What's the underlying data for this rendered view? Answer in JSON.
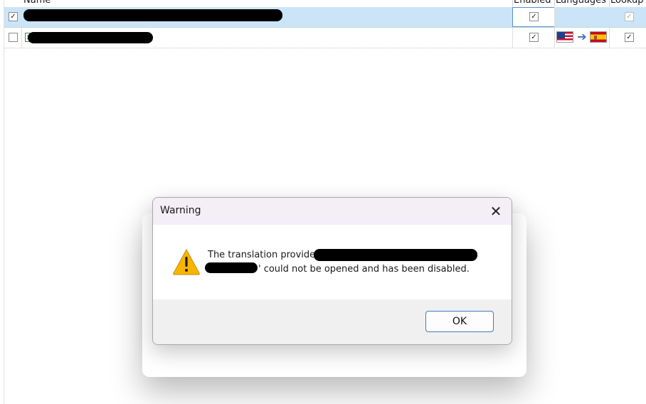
{
  "grid": {
    "columns": [
      {
        "key": "name",
        "label": "Name"
      },
      {
        "key": "enabled",
        "label": "Enabled"
      },
      {
        "key": "languages",
        "label": "Languages"
      },
      {
        "key": "lookup",
        "label": "Lookup"
      }
    ],
    "rows": [
      {
        "selected": true,
        "select_checked": true,
        "name_visible_fragment": "",
        "enabled": true,
        "languages": "",
        "lookup": true,
        "lookup_disabled": true
      },
      {
        "selected": false,
        "select_checked": false,
        "name_visible_fragment": "",
        "enabled": true,
        "source_flag": "us-flag-icon",
        "target_flag": "spain-flag-icon",
        "arrow": "➔",
        "lookup": true
      }
    ]
  },
  "dialog": {
    "title": "Warning",
    "close_glyph": "✕",
    "icon": "warning-icon",
    "message_line1": "The translation provider '",
    "message_line2": "' could not be opened and has been disabled.",
    "ok_label": "OK"
  },
  "colors": {
    "selected_row": "#cce4f7",
    "dialog_titlebar": "#f4eef7",
    "dialog_footer": "#f0f0f0",
    "ok_border": "#3f7fbf",
    "warning_fill": "#f7b500"
  }
}
